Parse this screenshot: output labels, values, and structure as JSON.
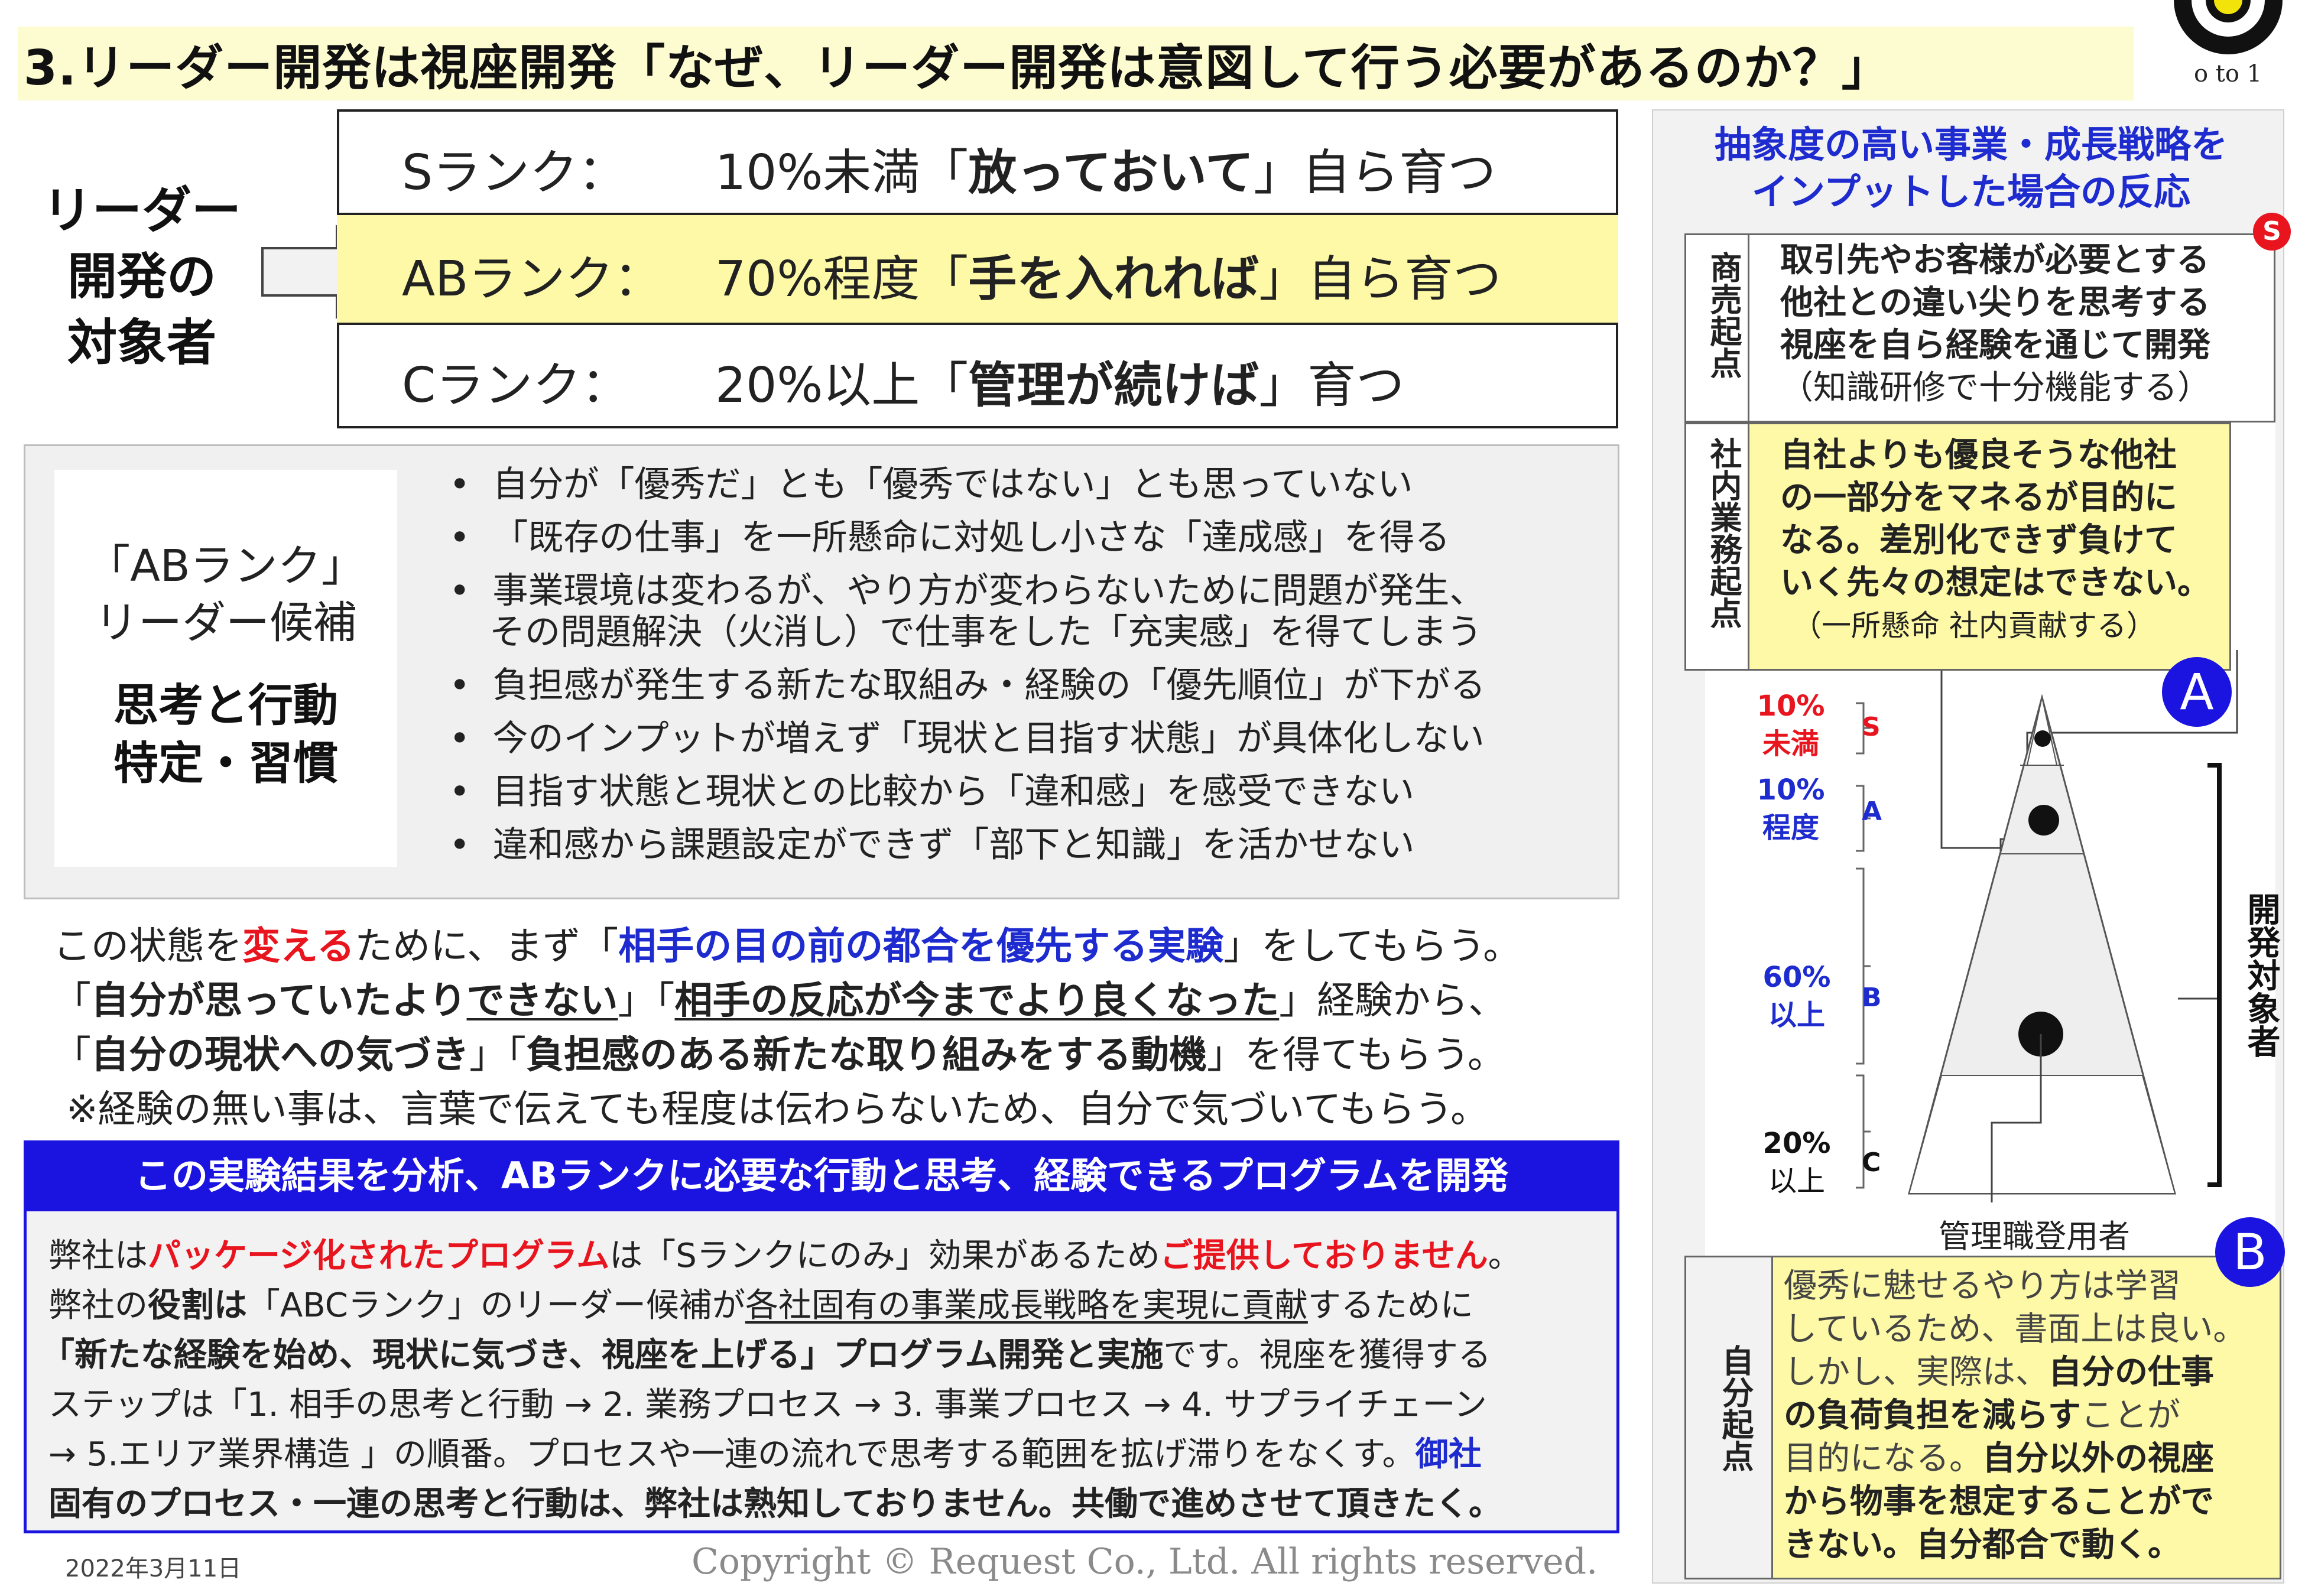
{
  "title": {
    "number": "3.",
    "main": "リーダー開発は視座開発「なぜ、リーダー開発は意図して行う必要があるのか？」",
    "logo_text": "o to 1"
  },
  "target_label": [
    "リーダー",
    "開発の",
    "対象者"
  ],
  "ranks": [
    {
      "name": "Sランク：",
      "pct": "10%未満",
      "open": "「",
      "key": "放っておいて",
      "close": "」自ら育つ"
    },
    {
      "name": "ABランク：",
      "pct": "70%程度",
      "open": "「",
      "key": "手を入れれば",
      "close": "」自ら育つ"
    },
    {
      "name": "Cランク：",
      "pct": "20%以上",
      "open": "「",
      "key": "管理が続けば",
      "close": "」育つ"
    }
  ],
  "candidate_box": {
    "label1": "「ABランク」",
    "label2": "リーダー候補",
    "label3": "思考と行動",
    "label4": "特定・習慣"
  },
  "bullets": [
    "自分が「優秀だ」とも「優秀ではない」とも思っていない",
    "「既存の仕事」を一所懸命に対処し小さな「達成感」を得る",
    "事業環境は変わるが、やり方が変わらないために問題が発生、",
    "その問題解決（火消し）で仕事をした「充実感」を得てしまう",
    "負担感が発生する新たな取組み・経験の「優先順位」が下がる",
    "今のインプットが増えず「現状と目指す状態」が具体化しない",
    "目指す状態と現状との比較から「違和感」を感受できない",
    "違和感から課題設定ができず「部下と知識」を活かせない"
  ],
  "paragraph": {
    "l1a": "この状態を",
    "l1b": "変える",
    "l1c": "ために、まず「",
    "l1d": "相手の目の前の都合を優先する実験",
    "l1e": "」をしてもらう。",
    "l2a": "「",
    "l2b": "自分が思っていたより",
    "l2c": "できない",
    "l2d": "」「",
    "l2e": "相手の反応が今までより良くなった",
    "l2f": "」経験から、",
    "l3a": "「",
    "l3b": "自分の現状への気づき",
    "l3c": "」「",
    "l3d": "負担感のある新たな取り組みをする動機",
    "l3e": "」を得てもらう。",
    "l4": "※経験の無い事は、言葉で伝えても程度は伝わらないため、自分で気づいてもらう。"
  },
  "program": {
    "header": "この実験結果を分析、ABランクに必要な行動と思考、経験できるプログラムを開発",
    "l1a": "弊社は",
    "l1b": "パッケージ化されたプログラム",
    "l1c": "は「Sランクにのみ」効果があるため",
    "l1d": "ご提供しておりません",
    "l1e": "。",
    "l2a": "弊社の",
    "l2b": "役割は",
    "l2c": "「ABCランク」のリーダー候補が",
    "l2d": "各社固有の事業成長戦略を実現に貢献",
    "l2e": "するために",
    "l3a": "「新たな経験を始め、現状に気づき、視座を上げる」プログラム開発と実施",
    "l3b": "です。視座を獲得する",
    "l4": "ステップは「1. 相手の思考と行動 → 2. 業務プロセス → 3. 事業プロセス → 4. サプライチェーン",
    "l5a": "→ 5.エリア業界構造 」の順番。プロセスや一連の流れで思考する範囲を拡げ滞りをなくす。",
    "l5b": "御社",
    "l6": "固有のプロセス・一連の思考と行動は、弊社は熟知しておりません。共働で進めさせて頂きたく。"
  },
  "date": "2022年3月11日",
  "copyright": "Copyright © Request Co., Ltd.  All rights reserved.",
  "right": {
    "header1": "抽象度の高い事業・成長戦略を",
    "header2": "インプットした場合の反応",
    "badge_s": "S",
    "badge_a": "A",
    "badge_b": "B",
    "shobai_label": "商売起点",
    "shobai": [
      "取引先やお客様が必要とする",
      "他社との違い尖りを思考する",
      "視座を自ら経験を通じて開発",
      "（知識研修で十分機能する）"
    ],
    "shanai_label": "社内業務起点",
    "shanai": [
      "自社よりも優良そうな他社",
      "の一部分をマネるが目的に",
      "なる。差別化できず負けて",
      "いく先々の想定はできない。",
      "（一所懸命 社内貢献する）"
    ],
    "jibun_label": "自分起点",
    "jibun": {
      "l1": "優秀に魅せるやり方は学習",
      "l2": "しているため、書面上は良い。",
      "l3a": "しかし、実際は、",
      "l3b": "自分の仕事",
      "l4a": "の負荷負担を減らす",
      "l4b": "ことが",
      "l5a": "目的になる。",
      "l5b": "自分以外の視座",
      "l6": "から物事を想定することがで",
      "l7": "きない。自分都合で動く。"
    },
    "pyramid": {
      "s_pct1": "10%",
      "s_pct2": "未満",
      "s_grade": "S",
      "a_pct1": "10%",
      "a_pct2": "程度",
      "a_grade": "A",
      "b_pct1": "60%",
      "b_pct2": "以上",
      "b_grade": "B",
      "c_pct1": "20%",
      "c_pct2": "以上",
      "c_grade": "C",
      "target_vertical": "開発対象者",
      "manager_label": "管理職登用者"
    }
  },
  "colors": {
    "title_bg": "#fdfbd0",
    "yellow_box": "#fdf9a6",
    "program_header": "#1b14e0",
    "accent_red": "#e8141e",
    "accent_blue": "#1e2ccf",
    "panel_gray": "#f0f0f0"
  }
}
